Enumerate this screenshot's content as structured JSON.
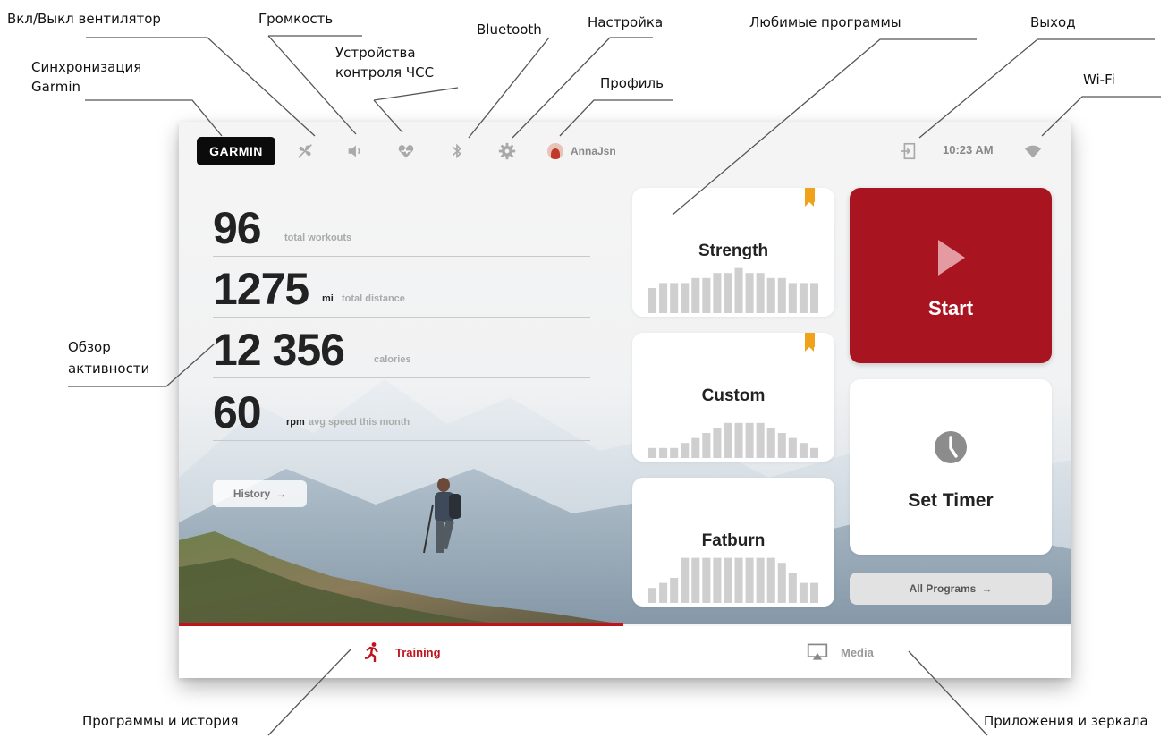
{
  "callouts": {
    "fan": "Вкл/Выкл вентилятор",
    "volume": "Громкость",
    "hr_devices_1": "Устройства",
    "hr_devices_2": "контроля ЧСС",
    "bluetooth": "Bluetooth",
    "settings": "Настройка",
    "favorites": "Любимые программы",
    "exit": "Выход",
    "garmin_sync_1": "Синхронизация",
    "garmin_sync_2": "Garmin",
    "profile": "Профиль",
    "wifi": "Wi-Fi",
    "activity_1": "Обзор",
    "activity_2": "активности",
    "programs_history": "Программы и история",
    "apps_mirroring": "Приложения и зеркала"
  },
  "topbar": {
    "logo": "GARMIN",
    "username": "AnnaJsn",
    "time": "10:23 AM",
    "icons": [
      "fan-icon",
      "volume-icon",
      "heart-rate-icon",
      "bluetooth-icon",
      "gear-icon",
      "exit-icon",
      "wifi-icon"
    ]
  },
  "stats": [
    {
      "value": "96",
      "unit": "",
      "desc": "total workouts"
    },
    {
      "value": "1275",
      "unit": "mi",
      "desc": "total distance"
    },
    {
      "value": "12 356",
      "unit": "",
      "desc": "calories"
    },
    {
      "value": "60",
      "unit": "rpm",
      "desc": "avg speed this month"
    }
  ],
  "history_label": "History",
  "programs": [
    {
      "name": "Strength",
      "bookmarked": true,
      "profile": [
        5,
        6,
        6,
        6,
        7,
        7,
        8,
        8,
        9,
        8,
        8,
        7,
        7,
        6,
        6,
        6
      ]
    },
    {
      "name": "Custom",
      "bookmarked": true,
      "profile": [
        2,
        2,
        2,
        3,
        4,
        5,
        6,
        7,
        7,
        7,
        7,
        6,
        5,
        4,
        3,
        2
      ]
    },
    {
      "name": "Fatburn",
      "bookmarked": false,
      "profile": [
        3,
        4,
        5,
        9,
        9,
        9,
        9,
        9,
        9,
        9,
        9,
        9,
        8,
        6,
        4,
        4
      ]
    }
  ],
  "start_label": "Start",
  "timer_label": "Set Timer",
  "all_programs_label": "All Programs",
  "nav": {
    "training": "Training",
    "media": "Media"
  },
  "colors": {
    "accent_red": "#a8141f",
    "bookmark": "#f0a21a",
    "bar": "#cfcfcf"
  }
}
